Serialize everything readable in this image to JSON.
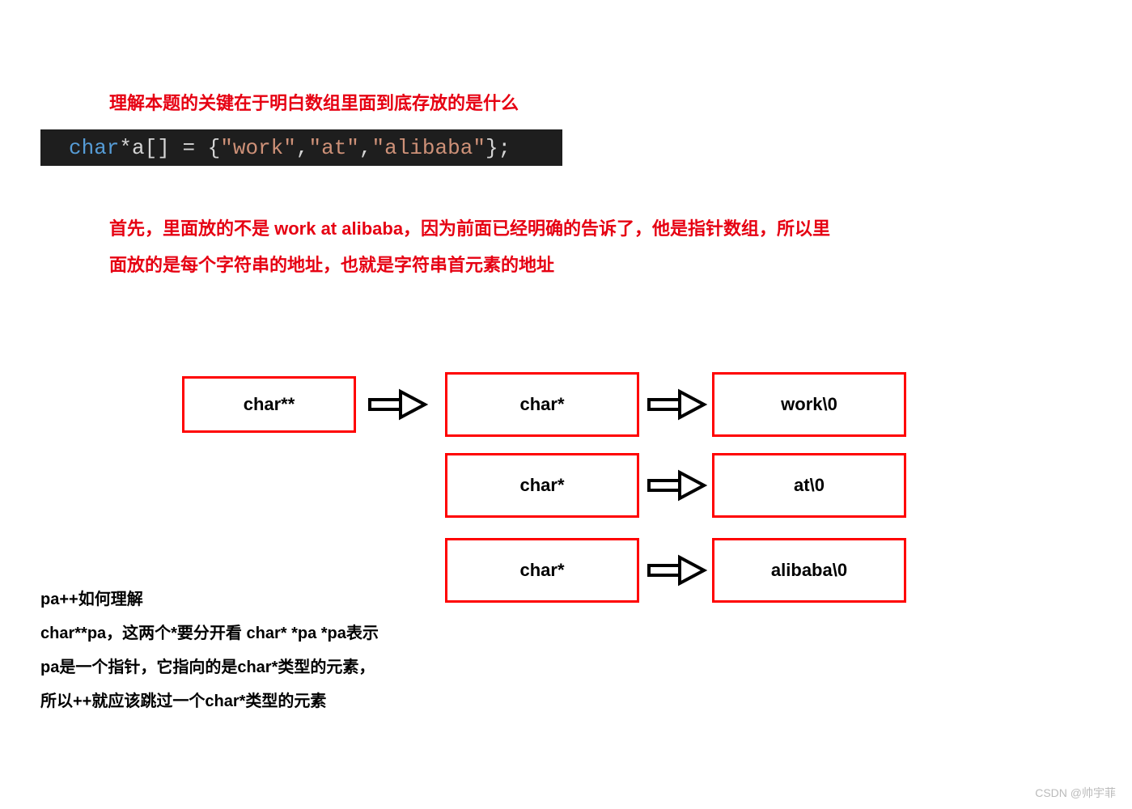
{
  "heading": "理解本题的关键在于明白数组里面到底存放的是什么",
  "code": {
    "kw": "char",
    "star": "* ",
    "var": "a[] = { ",
    "s1": "\"work\"",
    "c1": ",",
    "s2": "\"at\"",
    "c2": ",",
    "s3": "\"alibaba\"",
    "end": " };"
  },
  "para": "首先，里面放的不是 work at alibaba，因为前面已经明确的告诉了，他是指针数组，所以里面放的是每个字符串的地址，也就是字符串首元素的地址",
  "diagram": {
    "lvl0": "char**",
    "lvl1_a": "char*",
    "lvl1_b": "char*",
    "lvl1_c": "char*",
    "val_a": "work\\0",
    "val_b": "at\\0",
    "val_c": "alibaba\\0"
  },
  "explain": {
    "l1": "pa++如何理解",
    "l2": "char**pa，这两个*要分开看 char*  *pa   *pa表示pa是一个指针，它指向的是char*类型的元素，所以++就应该跳过一个char*类型的元素"
  },
  "watermark": "CSDN @帅宇菲"
}
